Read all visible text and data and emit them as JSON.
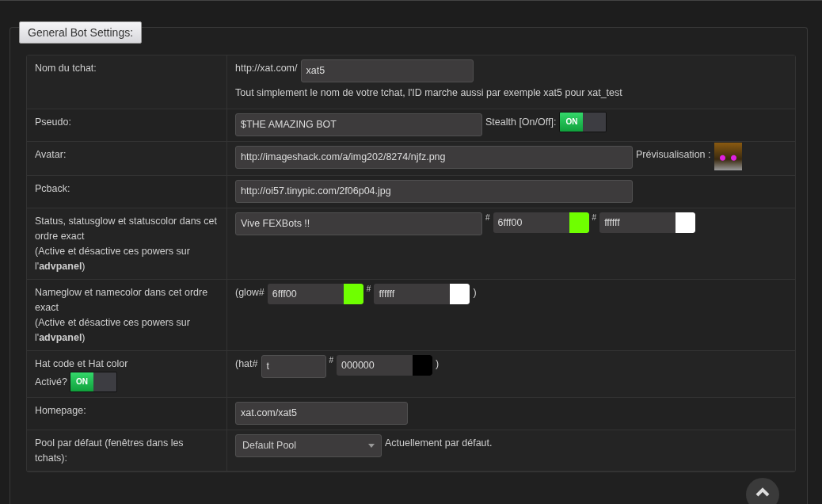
{
  "legend": "General Bot Settings:",
  "rows": [
    {
      "label": [
        "Nom du tchat:"
      ],
      "items": [
        {
          "kind": "text",
          "text": "http://xat.com/"
        },
        {
          "kind": "input",
          "value": "xat5"
        },
        {
          "kind": "text",
          "text": "Tout simplement le nom de votre tchat, l'ID marche aussi par exemple xat5 pour xat_test"
        }
      ]
    },
    {
      "label": [
        "Pseudo:"
      ],
      "items": [
        {
          "kind": "input",
          "value": "$THE AMAZING BOT"
        },
        {
          "kind": "text",
          "text": "Stealth [On/Off]:"
        },
        {
          "kind": "toggle",
          "label": "ON",
          "on": true
        }
      ]
    },
    {
      "label": [
        "Avatar:"
      ],
      "items": [
        {
          "kind": "input",
          "value": "http://imageshack.com/a/img202/8274/njfz.png"
        },
        {
          "kind": "text",
          "text": "Prévisualisation :"
        },
        {
          "kind": "image"
        }
      ]
    },
    {
      "label": [
        "Pcback:"
      ],
      "items": [
        {
          "kind": "input",
          "value": "http://oi57.tinypic.com/2f06p04.jpg"
        }
      ]
    },
    {
      "label": [
        "Status, statusglow et statuscolor dans cet ordre exact",
        "(Active et désactive ces powers sur l'**advpanel**)"
      ],
      "items": [
        {
          "kind": "input",
          "value": "Vive FEXBots !!"
        },
        {
          "kind": "hash",
          "text": "#"
        },
        {
          "kind": "color",
          "value": "6fff00",
          "color": "#6fff00"
        },
        {
          "kind": "hash",
          "text": "#"
        },
        {
          "kind": "color",
          "value": "ffffff",
          "color": "#ffffff"
        }
      ]
    },
    {
      "label": [
        "Nameglow et namecolor dans cet ordre exact",
        "(Active et désactive ces powers sur l'**advpanel**)"
      ],
      "items": [
        {
          "kind": "text",
          "text": "(glow#"
        },
        {
          "kind": "color",
          "value": "6fff00",
          "color": "#6fff00"
        },
        {
          "kind": "hash",
          "text": "#"
        },
        {
          "kind": "color",
          "value": "ffffff",
          "color": "#ffffff"
        },
        {
          "kind": "text",
          "text": ")"
        }
      ]
    },
    {
      "label": [
        "Hat code et Hat color"
      ],
      "label_text": "Activé?",
      "label_toggle": {
        "label": "ON",
        "on": true
      },
      "items": [
        {
          "kind": "text",
          "text": "(hat#"
        },
        {
          "kind": "input",
          "value": "t"
        },
        {
          "kind": "hash",
          "text": "#"
        },
        {
          "kind": "color",
          "value": "000000",
          "color": "#000000"
        },
        {
          "kind": "text",
          "text": ")"
        }
      ]
    },
    {
      "label": [
        "Homepage:"
      ],
      "items": [
        {
          "kind": "input",
          "value": "xat.com/xat5"
        }
      ]
    },
    {
      "label": [
        "Pool par défaut (fenêtres dans les tchats):"
      ],
      "items": [
        {
          "kind": "select",
          "value": "Default Pool"
        },
        {
          "kind": "text",
          "text": "Actuellement par défaut."
        }
      ]
    }
  ]
}
